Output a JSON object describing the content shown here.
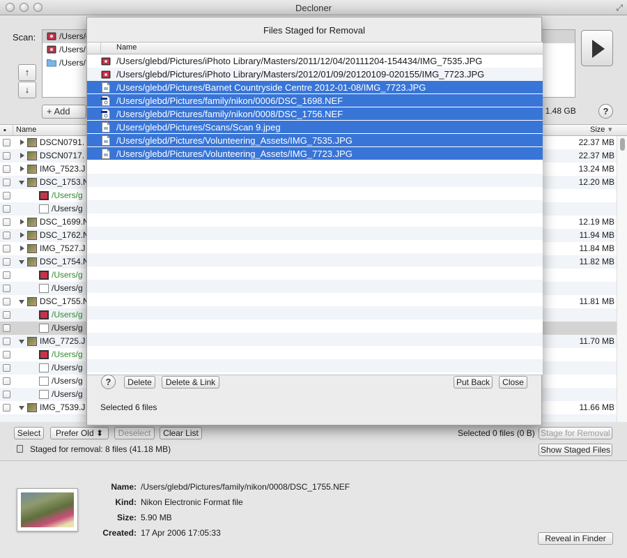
{
  "window": {
    "title": "Decloner"
  },
  "scan": {
    "label": "Scan:",
    "paths": [
      "/Users/glebd/Pictures/iPhoto Library",
      "/Users/",
      "/Users/"
    ],
    "up_arrow": "↑",
    "down_arrow": "↓",
    "add_label": "+  Add",
    "total_text": ": 1.48 GB",
    "help": "?"
  },
  "main_table": {
    "columns": {
      "name": "Name",
      "size": "Size"
    },
    "rows": [
      {
        "indent": 0,
        "disclosure": "right",
        "name": "DSCN0791.",
        "size": "22.37 MB",
        "color": "normal"
      },
      {
        "indent": 0,
        "disclosure": "right",
        "name": "DSCN0717.",
        "size": "22.37 MB",
        "color": "normal"
      },
      {
        "indent": 0,
        "disclosure": "right",
        "name": "IMG_7523.J",
        "size": "13.24 MB",
        "color": "normal"
      },
      {
        "indent": 0,
        "disclosure": "down",
        "name": "DSC_1753.N",
        "size": "12.20 MB",
        "color": "normal"
      },
      {
        "indent": 1,
        "disclosure": "none",
        "name": "/Users/g",
        "size": "",
        "color": "green"
      },
      {
        "indent": 1,
        "disclosure": "none",
        "name": "/Users/g",
        "size": "",
        "color": "normal"
      },
      {
        "indent": 0,
        "disclosure": "right",
        "name": "DSC_1699.N",
        "size": "12.19 MB",
        "color": "normal"
      },
      {
        "indent": 0,
        "disclosure": "right",
        "name": "DSC_1762.N",
        "size": "11.94 MB",
        "color": "normal"
      },
      {
        "indent": 0,
        "disclosure": "right",
        "name": "IMG_7527.J",
        "size": "11.84 MB",
        "color": "normal"
      },
      {
        "indent": 0,
        "disclosure": "down",
        "name": "DSC_1754.N",
        "size": "11.82 MB",
        "color": "normal"
      },
      {
        "indent": 1,
        "disclosure": "none",
        "name": "/Users/g",
        "size": "",
        "color": "green"
      },
      {
        "indent": 1,
        "disclosure": "none",
        "name": "/Users/g",
        "size": "",
        "color": "normal"
      },
      {
        "indent": 0,
        "disclosure": "down",
        "name": "DSC_1755.N",
        "size": "11.81 MB",
        "color": "normal"
      },
      {
        "indent": 1,
        "disclosure": "none",
        "name": "/Users/g",
        "size": "",
        "color": "green"
      },
      {
        "indent": 1,
        "disclosure": "none",
        "name": "/Users/g",
        "size": "",
        "color": "normal",
        "highlight": true
      },
      {
        "indent": 0,
        "disclosure": "down",
        "name": "IMG_7725.J",
        "size": "11.70 MB",
        "color": "normal"
      },
      {
        "indent": 1,
        "disclosure": "none",
        "name": "/Users/g",
        "size": "",
        "color": "green"
      },
      {
        "indent": 1,
        "disclosure": "none",
        "name": "/Users/g",
        "size": "",
        "color": "normal"
      },
      {
        "indent": 1,
        "disclosure": "none",
        "name": "/Users/g",
        "size": "",
        "color": "normal"
      },
      {
        "indent": 1,
        "disclosure": "none",
        "name": "/Users/g",
        "size": "",
        "color": "normal"
      },
      {
        "indent": 0,
        "disclosure": "down",
        "name": "IMG_7539.J",
        "size": "11.66 MB",
        "color": "normal"
      }
    ]
  },
  "toolbar": {
    "select": "Select",
    "prefer_old": "Prefer Old  ⬍",
    "deselect": "Deselect",
    "clear_list": "Clear List",
    "selected_status": "Selected 0 files (0 B)",
    "stage_for_removal": "Stage for Removal",
    "staged_status": "Staged for removal: 8 files (41.18 MB)",
    "show_staged": "Show Staged Files"
  },
  "info": {
    "name_label": "Name:",
    "name_value": "/Users/glebd/Pictures/family/nikon/0008/DSC_1755.NEF",
    "kind_label": "Kind:",
    "kind_value": "Nikon Electronic Format file",
    "size_label": "Size:",
    "size_value": "5.90 MB",
    "created_label": "Created:",
    "created_value": "17 Apr 2006 17:05:33",
    "reveal": "Reveal in Finder"
  },
  "sheet": {
    "title": "Files Staged for Removal",
    "column_name": "Name",
    "rows": [
      {
        "path": "/Users/glebd/Pictures/iPhoto Library/Masters/2011/12/04/20111204-154434/IMG_7535.JPG",
        "icon": "photo-icon",
        "selected": false
      },
      {
        "path": "/Users/glebd/Pictures/iPhoto Library/Masters/2012/01/09/20120109-020155/IMG_7723.JPG",
        "icon": "photo-icon",
        "selected": false
      },
      {
        "path": "/Users/glebd/Pictures/Barnet Countryside Centre 2012-01-08/IMG_7723.JPG",
        "icon": "document-icon",
        "selected": true
      },
      {
        "path": "/Users/glebd/Pictures/family/nikon/0006/DSC_1698.NEF",
        "icon": "raw-file-icon",
        "selected": true
      },
      {
        "path": "/Users/glebd/Pictures/family/nikon/0008/DSC_1756.NEF",
        "icon": "raw-file-icon",
        "selected": true
      },
      {
        "path": "/Users/glebd/Pictures/Scans/Scan 9.jpeg",
        "icon": "document-icon",
        "selected": true
      },
      {
        "path": "/Users/glebd/Pictures/Volunteering_Assets/IMG_7535.JPG",
        "icon": "document-icon",
        "selected": true
      },
      {
        "path": "/Users/glebd/Pictures/Volunteering_Assets/IMG_7723.JPG",
        "icon": "document-icon",
        "selected": true
      }
    ],
    "help": "?",
    "delete": "Delete",
    "delete_link": "Delete & Link",
    "put_back": "Put Back",
    "close": "Close",
    "selected_text": "Selected 6 files"
  },
  "colors": {
    "selection": "#3875d7",
    "green_text": "#2e8a2e",
    "alt_row": "#f1f4f8"
  }
}
